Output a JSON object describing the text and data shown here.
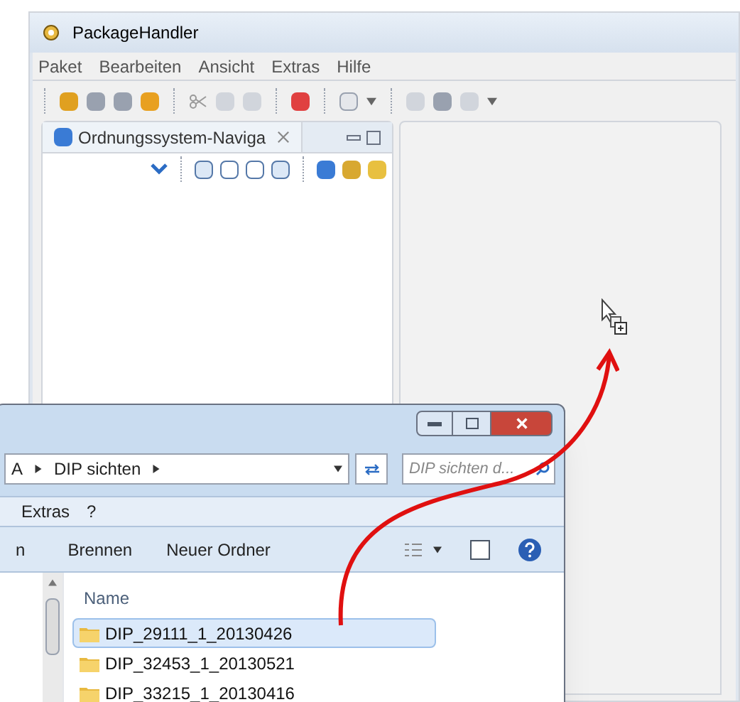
{
  "window": {
    "title": "PackageHandler"
  },
  "menu": [
    "Paket",
    "Bearbeiten",
    "Ansicht",
    "Extras",
    "Hilfe"
  ],
  "navigator": {
    "tab": "Ordnungssystem-Naviga"
  },
  "explorer": {
    "breadcrumb": [
      "A",
      "DIP sichten"
    ],
    "search": {
      "placeholder": "DIP sichten d..."
    },
    "menu": [
      "Extras",
      "?"
    ],
    "toolbar": [
      "n",
      "Brennen",
      "Neuer Ordner"
    ],
    "column": "Name",
    "rows": [
      {
        "name": "DIP_29111_1_20130426",
        "selected": true
      },
      {
        "name": "DIP_32453_1_20130521",
        "selected": false
      },
      {
        "name": "DIP_33215_1_20130416",
        "selected": false
      }
    ]
  }
}
